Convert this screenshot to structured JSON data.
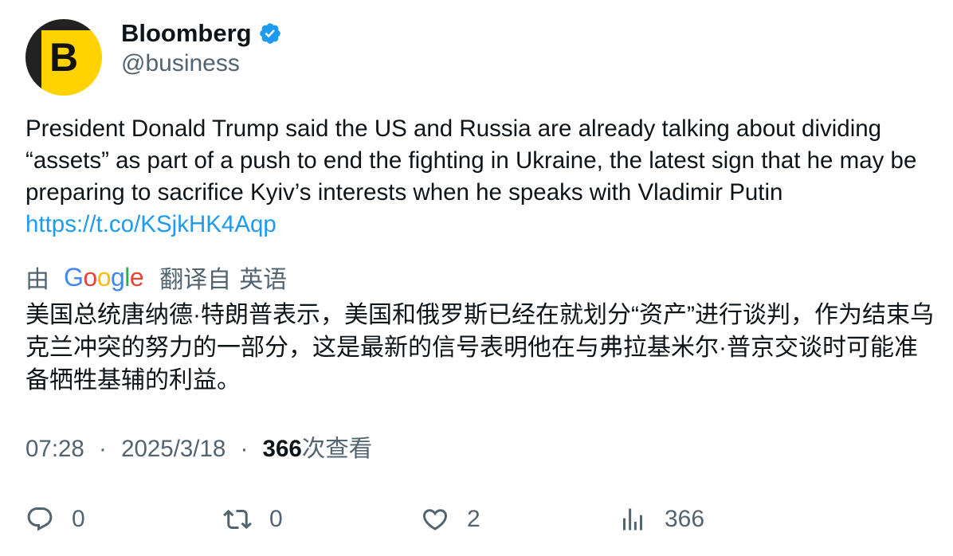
{
  "author": {
    "display_name": "Bloomberg",
    "handle": "@business",
    "avatar_letter": "B",
    "verified": true
  },
  "tweet": {
    "text": "President Donald Trump said the US and Russia are already talking about dividing “assets” as part of a push to end the fighting in Ukraine, the latest sign that he may be preparing to sacrifice Kyiv’s interests when he speaks with Vladimir Putin",
    "link": "https://t.co/KSjkHK4Aqp"
  },
  "translation": {
    "prefix": "由",
    "provider": "Google",
    "label": "翻译自",
    "language": "英语",
    "text": "美国总统唐纳德·特朗普表示，美国和俄罗斯已经在就划分“资产”进行谈判，作为结束乌克兰冲突的努力的一部分，这是最新的信号表明他在与弗拉基米尔·普京交谈时可能准备牺牲基辅的利益。"
  },
  "meta": {
    "time": "07:28",
    "separator": "·",
    "date": "2025/3/18",
    "views_count": "366",
    "views_label": "次查看"
  },
  "actions": {
    "reply_count": "0",
    "retweet_count": "0",
    "like_count": "2",
    "views_count": "366"
  },
  "colors": {
    "text_primary": "#0f1419",
    "text_secondary": "#536471",
    "link": "#1d9bf0",
    "verified": "#1d9bf0",
    "avatar_bg": "#ffd200"
  }
}
